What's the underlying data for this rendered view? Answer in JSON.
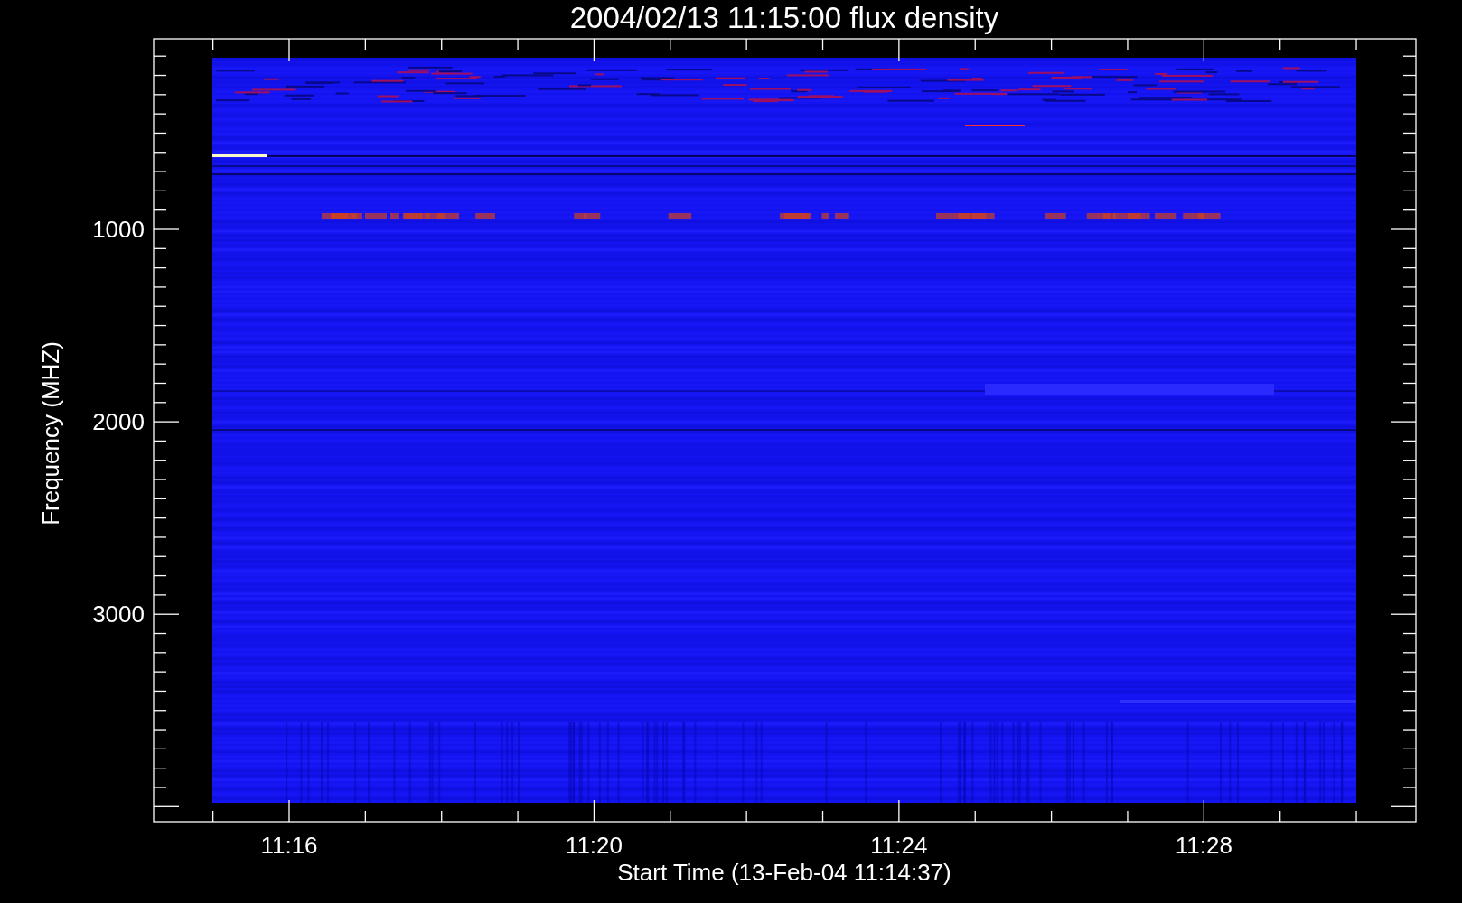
{
  "plot": {
    "title": "2004/02/13 11:15:00 flux density",
    "xlabel": "Start Time (13-Feb-04 11:14:37)",
    "ylabel": "Frequency (MHZ)",
    "xtick_labels": [
      "11:16",
      "11:20",
      "11:24",
      "11:28"
    ],
    "ytick_labels": [
      "1000",
      "2000",
      "3000"
    ]
  }
}
